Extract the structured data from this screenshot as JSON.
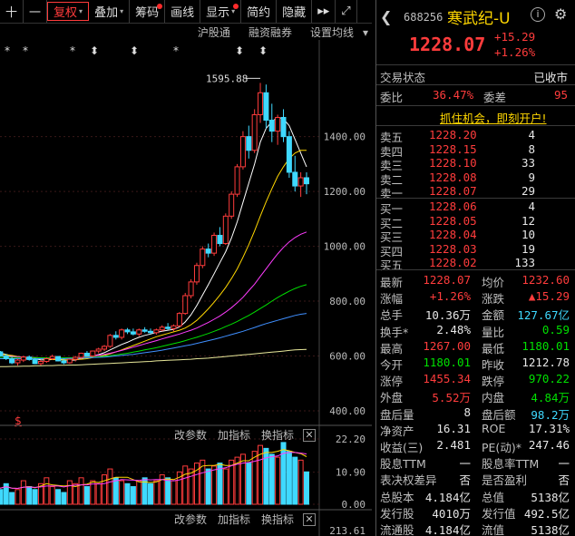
{
  "toolbar": {
    "items": [
      {
        "label": "十",
        "active": false,
        "dot": false,
        "arrow": false
      },
      {
        "label": "一",
        "active": false,
        "dot": false,
        "arrow": false
      },
      {
        "label": "复权",
        "active": true,
        "dot": false,
        "arrow": true
      },
      {
        "label": "叠加",
        "active": false,
        "dot": false,
        "arrow": true
      },
      {
        "label": "筹码",
        "active": false,
        "dot": true,
        "arrow": false
      },
      {
        "label": "画线",
        "active": false,
        "dot": false,
        "arrow": false
      },
      {
        "label": "显示",
        "active": false,
        "dot": true,
        "arrow": true
      },
      {
        "label": "简约",
        "active": false,
        "dot": false,
        "arrow": false
      },
      {
        "label": "隐藏",
        "active": false,
        "dot": false,
        "arrow": false
      }
    ],
    "more_icon": "▸▸",
    "fullscreen_icon": "⤢"
  },
  "subbar": {
    "items": [
      "沪股通",
      "融资融券",
      "设置均线"
    ]
  },
  "price_axis": [
    "1400.00",
    "1200.00",
    "1000.00",
    "800.00",
    "600.00",
    "400.00"
  ],
  "high_marker": "1595.88",
  "star_markers": [
    "*",
    "*",
    "*",
    "⬍",
    "⬍",
    "*",
    "⬍",
    "⬍"
  ],
  "dollar_marker": "$",
  "indicator_bar": {
    "items": [
      "改参数",
      "加指标",
      "换指标"
    ],
    "close": "✕"
  },
  "volume_axis": [
    "22.20",
    "10.90",
    "0.00"
  ],
  "bottom_axis_value": "213.61",
  "chart_data": {
    "type": "candlestick",
    "ylim": [
      380,
      1680
    ],
    "candles": [
      [
        610,
        620,
        605,
        615
      ],
      [
        615,
        618,
        598,
        600
      ],
      [
        600,
        608,
        585,
        590
      ],
      [
        590,
        596,
        570,
        575
      ],
      [
        575,
        590,
        565,
        585
      ],
      [
        585,
        600,
        578,
        596
      ],
      [
        596,
        602,
        583,
        587
      ],
      [
        587,
        592,
        570,
        572
      ],
      [
        572,
        585,
        565,
        580
      ],
      [
        580,
        595,
        575,
        590
      ],
      [
        590,
        605,
        585,
        598
      ],
      [
        598,
        600,
        580,
        582
      ],
      [
        582,
        590,
        570,
        575
      ],
      [
        575,
        590,
        572,
        588
      ],
      [
        588,
        600,
        580,
        595
      ],
      [
        595,
        612,
        590,
        610
      ],
      [
        610,
        618,
        598,
        600
      ],
      [
        600,
        620,
        596,
        618
      ],
      [
        618,
        630,
        610,
        625
      ],
      [
        625,
        640,
        618,
        635
      ],
      [
        635,
        680,
        630,
        675
      ],
      [
        675,
        690,
        660,
        668
      ],
      [
        668,
        700,
        660,
        695
      ],
      [
        695,
        702,
        680,
        688
      ],
      [
        688,
        700,
        675,
        680
      ],
      [
        680,
        700,
        672,
        695
      ],
      [
        695,
        705,
        685,
        690
      ],
      [
        690,
        700,
        680,
        685
      ],
      [
        685,
        700,
        678,
        695
      ],
      [
        695,
        712,
        690,
        705
      ],
      [
        705,
        720,
        695,
        700
      ],
      [
        700,
        715,
        690,
        710
      ],
      [
        710,
        760,
        705,
        755
      ],
      [
        755,
        830,
        750,
        820
      ],
      [
        820,
        880,
        810,
        870
      ],
      [
        870,
        940,
        860,
        930
      ],
      [
        930,
        1000,
        920,
        990
      ],
      [
        990,
        1010,
        960,
        975
      ],
      [
        975,
        1050,
        965,
        1040
      ],
      [
        1040,
        1070,
        1000,
        1010
      ],
      [
        1010,
        1120,
        1005,
        1110
      ],
      [
        1110,
        1200,
        1100,
        1190
      ],
      [
        1190,
        1300,
        1180,
        1290
      ],
      [
        1290,
        1420,
        1280,
        1400
      ],
      [
        1400,
        1440,
        1320,
        1350
      ],
      [
        1350,
        1500,
        1340,
        1480
      ],
      [
        1480,
        1595.88,
        1450,
        1560
      ],
      [
        1560,
        1590,
        1430,
        1460
      ],
      [
        1460,
        1520,
        1380,
        1420
      ],
      [
        1420,
        1480,
        1370,
        1470
      ],
      [
        1470,
        1500,
        1380,
        1400
      ],
      [
        1400,
        1420,
        1250,
        1270
      ],
      [
        1270,
        1330,
        1200,
        1220
      ],
      [
        1220,
        1270,
        1180,
        1250
      ],
      [
        1250,
        1270,
        1190,
        1228.07
      ]
    ],
    "ma_lines": [
      {
        "color": "#ffffff",
        "values": [
          612,
          610,
          606,
          600,
          596,
          595,
          594,
          590,
          586,
          585,
          587,
          588,
          586,
          584,
          585,
          590,
          596,
          600,
          605,
          612,
          622,
          632,
          642,
          650,
          660,
          668,
          675,
          680,
          686,
          690,
          694,
          697,
          706,
          724,
          750,
          784,
          822,
          860,
          900,
          940,
          980,
          1030,
          1090,
          1160,
          1230,
          1300,
          1380,
          1430,
          1455,
          1470,
          1465,
          1440,
          1390,
          1340,
          1290
        ]
      },
      {
        "color": "#ffd700",
        "values": [
          608,
          606,
          604,
          602,
          598,
          596,
          594,
          592,
          590,
          588,
          587,
          586,
          586,
          586,
          587,
          588,
          590,
          594,
          598,
          602,
          608,
          615,
          622,
          630,
          638,
          646,
          654,
          662,
          670,
          676,
          682,
          688,
          694,
          702,
          714,
          730,
          750,
          772,
          796,
          822,
          850,
          882,
          918,
          960,
          1006,
          1056,
          1110,
          1162,
          1210,
          1255,
          1290,
          1320,
          1340,
          1350,
          1350
        ]
      },
      {
        "color": "#ff3cff",
        "values": [
          600,
          600,
          599,
          598,
          597,
          596,
          595,
          594,
          593,
          592,
          592,
          592,
          592,
          593,
          594,
          595,
          597,
          600,
          603,
          606,
          610,
          615,
          620,
          626,
          632,
          638,
          644,
          650,
          656,
          662,
          668,
          674,
          680,
          687,
          694,
          702,
          712,
          722,
          734,
          746,
          760,
          776,
          794,
          814,
          838,
          862,
          890,
          918,
          946,
          972,
          996,
          1016,
          1032,
          1044,
          1052
        ]
      },
      {
        "color": "#00e000",
        "values": [
          595,
          595,
          595,
          595,
          594,
          594,
          594,
          594,
          593,
          593,
          593,
          593,
          593,
          593,
          594,
          594,
          595,
          596,
          597,
          599,
          601,
          604,
          607,
          610,
          614,
          618,
          622,
          626,
          630,
          635,
          640,
          645,
          650,
          656,
          662,
          668,
          675,
          682,
          690,
          698,
          707,
          716,
          726,
          737,
          748,
          760,
          773,
          786,
          800,
          813,
          825,
          836,
          846,
          854,
          860
        ]
      },
      {
        "color": "#3f8fff",
        "values": [
          590,
          590,
          590,
          590,
          590,
          590,
          590,
          590,
          590,
          590,
          590,
          590,
          590,
          591,
          591,
          592,
          593,
          594,
          595,
          596,
          598,
          600,
          602,
          604,
          606,
          609,
          612,
          615,
          618,
          621,
          625,
          629,
          633,
          637,
          641,
          646,
          651,
          656,
          661,
          666,
          672,
          678,
          684,
          690,
          697,
          704,
          711,
          718,
          724,
          730,
          736,
          742,
          748,
          752,
          755
        ]
      },
      {
        "color": "#e8e89a",
        "values": [
          560,
          561,
          561,
          562,
          562,
          563,
          563,
          564,
          564,
          565,
          565,
          566,
          566,
          567,
          567,
          568,
          569,
          570,
          571,
          572,
          573,
          574,
          575,
          576,
          577,
          578,
          579,
          580,
          582,
          583,
          584,
          585,
          586,
          587,
          588,
          590,
          591,
          592,
          594,
          596,
          598,
          600,
          602,
          604,
          606,
          608,
          610,
          612,
          614,
          616,
          618,
          620,
          622,
          623,
          624
        ]
      }
    ],
    "volumes": [
      6,
      5,
      7,
      4,
      5,
      8,
      6,
      5,
      7,
      9,
      6,
      5,
      4,
      8,
      7,
      9,
      6,
      8,
      7,
      10,
      12,
      9,
      8,
      7,
      6,
      8,
      9,
      7,
      8,
      10,
      9,
      8,
      11,
      13,
      12,
      14,
      15,
      12,
      13,
      14,
      12,
      15,
      16,
      17,
      14,
      18,
      20,
      19,
      17,
      16,
      21,
      18,
      16,
      15,
      11
    ],
    "volume_ylim": [
      0,
      22.2
    ]
  },
  "quote": {
    "code": "688256",
    "name": "寒武纪-U",
    "price": "1228.07",
    "change": "+15.29",
    "change_pct": "+1.26%",
    "status_label": "交易状态",
    "status_value": "已收市",
    "weibi_label": "委比",
    "weibi_value": "36.47%",
    "weicha_label": "委差",
    "weicha_value": "95",
    "promo": "抓住机会，即刻开户!"
  },
  "sell_orders": [
    {
      "label": "卖五",
      "price": "1228.20",
      "vol": "4"
    },
    {
      "label": "卖四",
      "price": "1228.15",
      "vol": "8"
    },
    {
      "label": "卖三",
      "price": "1228.10",
      "vol": "33"
    },
    {
      "label": "卖二",
      "price": "1228.08",
      "vol": "9"
    },
    {
      "label": "卖一",
      "price": "1228.07",
      "vol": "29"
    }
  ],
  "buy_orders": [
    {
      "label": "买一",
      "price": "1228.06",
      "vol": "4"
    },
    {
      "label": "买二",
      "price": "1228.05",
      "vol": "12"
    },
    {
      "label": "买三",
      "price": "1228.04",
      "vol": "10"
    },
    {
      "label": "买四",
      "price": "1228.03",
      "vol": "19"
    },
    {
      "label": "买五",
      "price": "1228.02",
      "vol": "133"
    }
  ],
  "stats": [
    {
      "l1": "最新",
      "v1": "1228.07",
      "c1": "red",
      "l2": "均价",
      "v2": "1232.60",
      "c2": "red"
    },
    {
      "l1": "涨幅",
      "v1": "+1.26%",
      "c1": "red",
      "l2": "涨跌",
      "v2": "▲15.29",
      "c2": "red"
    },
    {
      "l1": "总手",
      "v1": "10.36万",
      "c1": "wht",
      "l2": "金额",
      "v2": "127.67亿",
      "c2": "cyn"
    },
    {
      "l1": "换手*",
      "v1": "2.48%",
      "c1": "wht",
      "l2": "量比",
      "v2": "0.59",
      "c2": "grn"
    },
    {
      "l1": "最高",
      "v1": "1267.00",
      "c1": "red",
      "l2": "最低",
      "v2": "1180.01",
      "c2": "grn"
    },
    {
      "l1": "今开",
      "v1": "1180.01",
      "c1": "grn",
      "l2": "昨收",
      "v2": "1212.78",
      "c2": "wht"
    },
    {
      "l1": "涨停",
      "v1": "1455.34",
      "c1": "red",
      "l2": "跌停",
      "v2": "970.22",
      "c2": "grn"
    },
    {
      "l1": "外盘",
      "v1": "5.52万",
      "c1": "red",
      "l2": "内盘",
      "v2": "4.84万",
      "c2": "grn"
    },
    {
      "l1": "盘后量",
      "v1": "8",
      "c1": "wht",
      "l2": "盘后额",
      "v2": "98.2万",
      "c2": "cyn"
    },
    {
      "l1": "净资产",
      "v1": "16.31",
      "c1": "wht",
      "l2": "ROE",
      "v2": "17.31%",
      "c2": "wht"
    },
    {
      "l1": "收益(三)",
      "v1": "2.481",
      "c1": "wht",
      "l2": "PE(动)*",
      "v2": "247.46",
      "c2": "wht"
    },
    {
      "l1": "股息TTM",
      "v1": "一",
      "c1": "wht",
      "l2": "股息率TTM",
      "v2": "一",
      "c2": "wht"
    },
    {
      "l1": "表决权差异",
      "v1": "否",
      "c1": "wht",
      "l2": "是否盈利",
      "v2": "否",
      "c2": "wht"
    },
    {
      "l1": "总股本",
      "v1": "4.184亿",
      "c1": "wht",
      "l2": "总值",
      "v2": "5138亿",
      "c2": "wht"
    },
    {
      "l1": "发行股",
      "v1": "4010万",
      "c1": "wht",
      "l2": "发行值",
      "v2": "492.5亿",
      "c2": "wht"
    },
    {
      "l1": "流通股",
      "v1": "4.184亿",
      "c1": "wht",
      "l2": "流值",
      "v2": "5138亿",
      "c2": "wht"
    }
  ]
}
